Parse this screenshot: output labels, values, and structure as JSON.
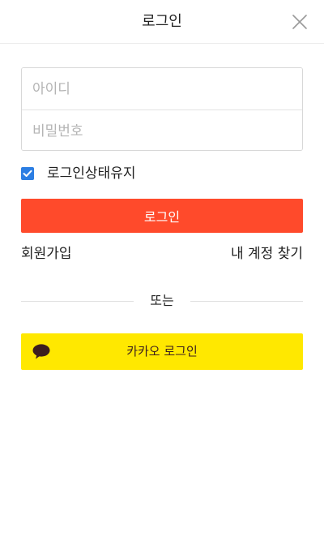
{
  "header": {
    "title": "로그인",
    "close_icon": "close-icon"
  },
  "form": {
    "id_placeholder": "아이디",
    "id_value": "",
    "password_placeholder": "비밀번호",
    "password_value": "",
    "keep_login_label": "로그인상태유지",
    "keep_login_checked": true,
    "login_button": "로그인"
  },
  "links": {
    "signup": "회원가입",
    "find_account": "내 계정 찾기"
  },
  "divider": {
    "text": "또는"
  },
  "kakao": {
    "label": "카카오 로그인",
    "icon": "speech-bubble-icon"
  },
  "colors": {
    "accent": "#ff4a2b",
    "checkbox": "#2c7ee3",
    "kakao_yellow": "#ffe800",
    "kakao_brown": "#3c1e1e"
  }
}
